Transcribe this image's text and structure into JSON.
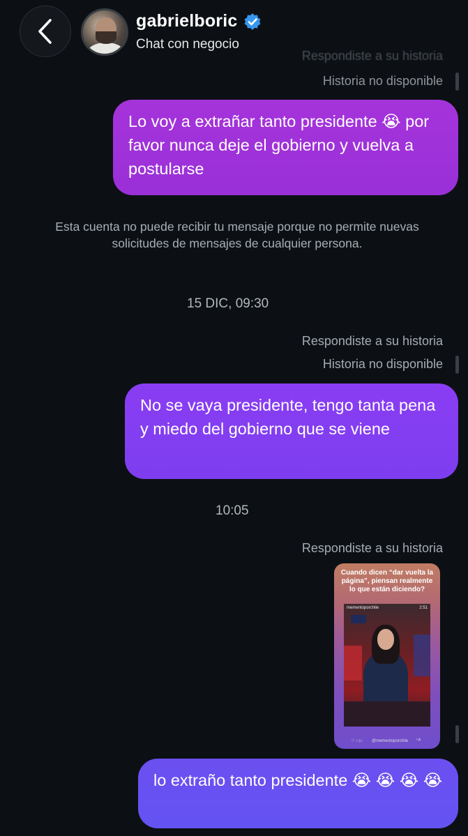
{
  "header": {
    "username": "gabrielboric",
    "subtitle": "Chat con negocio"
  },
  "thread": {
    "ghost_reply_label": "Respondiste a su historia",
    "ghost_story_unavailable": "Historia no disponible",
    "message1": "Lo voy a extrañar tanto presidente 😭 por favor nunca deje el gobierno y vuelva a postularse",
    "notice": "Esta cuenta no puede recibir tu mensaje porque no permite nuevas solicitudes de mensajes de cualquier persona.",
    "timestamp1": "15 DIC, 09:30",
    "reply_label_1": "Respondiste a su historia",
    "story_unavailable_1": "Historia no disponible",
    "message2": "No se vaya presidente, tengo tanta pena y miedo del gobierno que se viene",
    "timestamp2": "10:05",
    "reply_label_2": "Respondiste a su historia",
    "message3": "lo extraño tanto presidente 😭 😭 😭 😭"
  },
  "story": {
    "caption": "Cuando dicen “dar vuelta la página”, piensan realmente lo que están diciendo?",
    "account": "mementoporchile",
    "video_time": "2:51",
    "footer_handle": "@mementoporchile",
    "footer_icons": "♡ ○ ▷",
    "footer_right": "⁺ᴬ"
  },
  "icons": {
    "back": "chevron-left-icon",
    "verified": "verified-badge-icon"
  },
  "colors": {
    "background": "#0c1014",
    "verified": "#3897f0",
    "bubble1": "#a533da",
    "bubble2": "#8a3df2",
    "bubble3": "#6c4ff0"
  }
}
